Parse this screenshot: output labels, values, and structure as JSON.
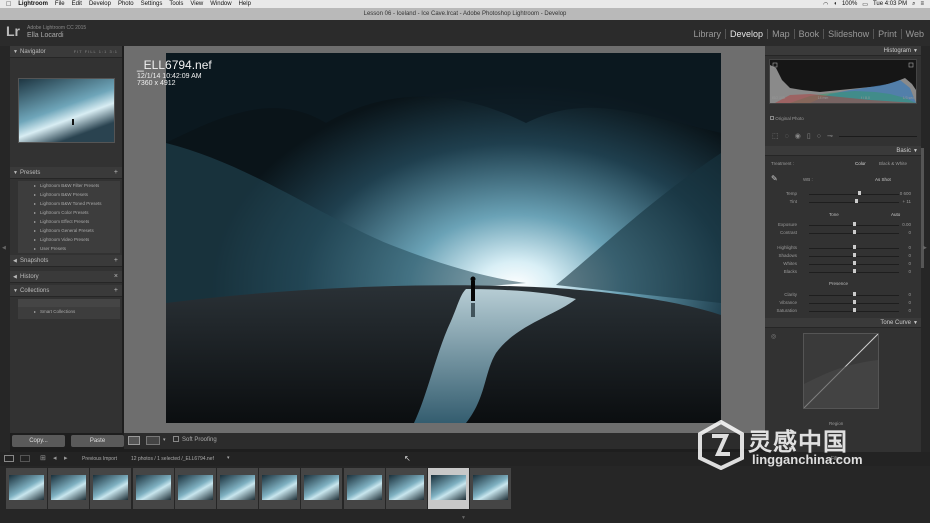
{
  "menubar": {
    "apple": "",
    "items": [
      "Lightroom",
      "File",
      "Edit",
      "Develop",
      "Photo",
      "Settings",
      "Tools",
      "View",
      "Window",
      "Help"
    ],
    "battery": "100%",
    "clock": "Tue 4:03 PM"
  },
  "window_title": "Lesson 06 - Iceland - Ice Cave.lrcat - Adobe Photoshop Lightroom - Develop",
  "identity": {
    "logo": "Lr",
    "product": "Adobe Lightroom CC 2015",
    "user": "Ella Locardi"
  },
  "modules": [
    "Library",
    "Develop",
    "Map",
    "Book",
    "Slideshow",
    "Print",
    "Web"
  ],
  "active_module": "Develop",
  "left_panel": {
    "navigator": {
      "title": "Navigator",
      "zoom": [
        "FIT",
        "FILL",
        "1:1",
        "3:1"
      ]
    },
    "presets": {
      "title": "Presets",
      "items": [
        "Lightroom B&W Filter Presets",
        "Lightroom B&W Presets",
        "Lightroom B&W Toned Presets",
        "Lightroom Color Presets",
        "Lightroom Effect Presets",
        "Lightroom General Presets",
        "Lightroom Video Presets",
        "User Presets"
      ]
    },
    "snapshots": "Snapshots",
    "history": "History",
    "collections": {
      "title": "Collections",
      "items": [
        "Smart Collections"
      ]
    },
    "copy_btn": "Copy...",
    "paste_btn": "Paste"
  },
  "photo_info": {
    "filename": "_ELL6794.nef",
    "date": "12/1/14 10:42:09 AM",
    "dims": "7360 x 4912"
  },
  "toolbar": {
    "soft_proofing": "Soft Proofing"
  },
  "right_panel": {
    "histogram_title": "Histogram",
    "histogram_info": [
      "ISO 100",
      "14 mm",
      "f / 8.0",
      "1/3 sec"
    ],
    "original_photo": "Original Photo",
    "basic_title": "Basic",
    "treatment_label": "Treatment :",
    "treatment_options": [
      "Color",
      "Black & White"
    ],
    "wb_label": "WB :",
    "wb_value": "As Shot",
    "tone_label": "Tone",
    "tone_auto": "Auto",
    "presence_label": "Presence",
    "sliders": [
      {
        "name": "Temp",
        "value": "0 600",
        "pos": 0.55
      },
      {
        "name": "Tint",
        "value": "+ 11",
        "pos": 0.52
      },
      {
        "name": "Exposure",
        "value": "0.00",
        "pos": 0.5
      },
      {
        "name": "Contrast",
        "value": "0",
        "pos": 0.5
      },
      {
        "name": "Highlights",
        "value": "0",
        "pos": 0.5
      },
      {
        "name": "Shadows",
        "value": "0",
        "pos": 0.5
      },
      {
        "name": "Whites",
        "value": "0",
        "pos": 0.5
      },
      {
        "name": "Blacks",
        "value": "0",
        "pos": 0.5
      },
      {
        "name": "Clarity",
        "value": "0",
        "pos": 0.5
      },
      {
        "name": "Vibrance",
        "value": "0",
        "pos": 0.5
      },
      {
        "name": "Saturation",
        "value": "0",
        "pos": 0.5
      }
    ],
    "tone_curve_title": "Tone Curve",
    "region_label": "Region"
  },
  "filmstrip": {
    "source_label": "Previous Import",
    "count_label": "12 photos / 1 selected /_ELL6794.nef",
    "filter_label": "Filter :",
    "thumb_count": 12,
    "selected_index": 10
  },
  "watermark": {
    "big": "灵感中国",
    "small": "lingganchina.com"
  }
}
